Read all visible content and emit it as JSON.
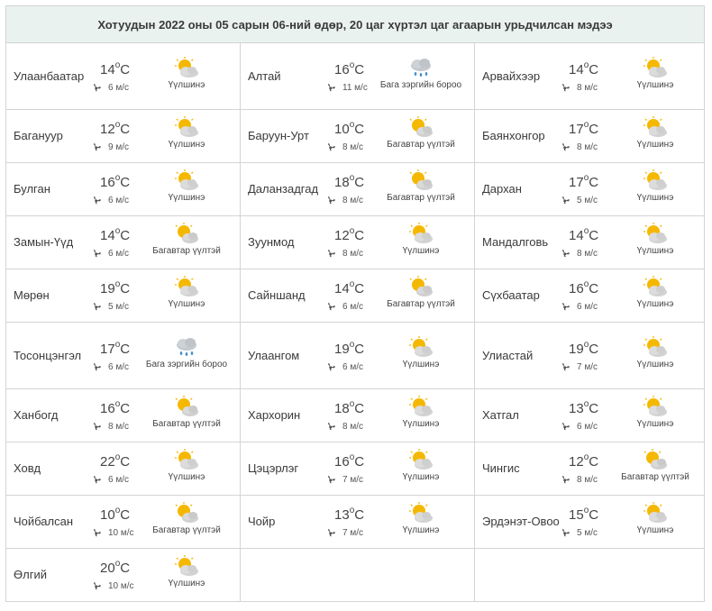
{
  "title": "Хотуудын 2022 оны 05 сарын 06-ний өдөр, 20 цаг хүртэл цаг агаарын урьдчилсан мэдээ",
  "unit": "C",
  "colors": {
    "header_bg": "#eaf2f0",
    "border": "#d4d4d4",
    "sun": "#f5b800",
    "cloud": "#c9c9c9"
  },
  "rows": [
    [
      {
        "city": "Улаанбаатар",
        "temp": "14",
        "wind": "6 м/с",
        "cond": "Үүлшинэ",
        "icon": "partly-cloudy-icon"
      },
      {
        "city": "Алтай",
        "temp": "16",
        "wind": "11 м/с",
        "cond": "Бага зэргийн бороо",
        "icon": "light-rain-icon"
      },
      {
        "city": "Арвайхээр",
        "temp": "14",
        "wind": "8 м/с",
        "cond": "Үүлшинэ",
        "icon": "partly-cloudy-icon"
      }
    ],
    [
      {
        "city": "Баганууp",
        "temp": "12",
        "wind": "9 м/с",
        "cond": "Үүлшинэ",
        "icon": "partly-cloudy-icon"
      },
      {
        "city": "Баруун-Урт",
        "temp": "10",
        "wind": "8 м/с",
        "cond": "Багавтар үүлтэй",
        "icon": "mostly-sunny-icon"
      },
      {
        "city": "Баянхонгор",
        "temp": "17",
        "wind": "8 м/с",
        "cond": "Үүлшинэ",
        "icon": "partly-cloudy-icon"
      }
    ],
    [
      {
        "city": "Булган",
        "temp": "16",
        "wind": "6 м/с",
        "cond": "Үүлшинэ",
        "icon": "partly-cloudy-icon"
      },
      {
        "city": "Даланзадгад",
        "temp": "18",
        "wind": "8 м/с",
        "cond": "Багавтар үүлтэй",
        "icon": "mostly-sunny-icon"
      },
      {
        "city": "Дархан",
        "temp": "17",
        "wind": "5 м/с",
        "cond": "Үүлшинэ",
        "icon": "partly-cloudy-icon"
      }
    ],
    [
      {
        "city": "Замын-Үүд",
        "temp": "14",
        "wind": "6 м/с",
        "cond": "Багавтар үүлтэй",
        "icon": "mostly-sunny-icon"
      },
      {
        "city": "Зуунмод",
        "temp": "12",
        "wind": "8 м/с",
        "cond": "Үүлшинэ",
        "icon": "partly-cloudy-icon"
      },
      {
        "city": "Мандалговь",
        "temp": "14",
        "wind": "8 м/с",
        "cond": "Үүлшинэ",
        "icon": "partly-cloudy-icon"
      }
    ],
    [
      {
        "city": "Мөрөн",
        "temp": "19",
        "wind": "5 м/с",
        "cond": "Үүлшинэ",
        "icon": "partly-cloudy-icon"
      },
      {
        "city": "Сайншанд",
        "temp": "14",
        "wind": "6 м/с",
        "cond": "Багавтар үүлтэй",
        "icon": "mostly-sunny-icon"
      },
      {
        "city": "Сүхбаатар",
        "temp": "16",
        "wind": "6 м/с",
        "cond": "Үүлшинэ",
        "icon": "partly-cloudy-icon"
      }
    ],
    [
      {
        "city": "Тосонцэнгэл",
        "temp": "17",
        "wind": "6 м/с",
        "cond": "Бага зэргийн бороо",
        "icon": "light-rain-icon"
      },
      {
        "city": "Улаангом",
        "temp": "19",
        "wind": "6 м/с",
        "cond": "Үүлшинэ",
        "icon": "partly-cloudy-icon"
      },
      {
        "city": "Улиастай",
        "temp": "19",
        "wind": "7 м/с",
        "cond": "Үүлшинэ",
        "icon": "partly-cloudy-icon"
      }
    ],
    [
      {
        "city": "Ханбогд",
        "temp": "16",
        "wind": "8 м/с",
        "cond": "Багавтар үүлтэй",
        "icon": "mostly-sunny-icon"
      },
      {
        "city": "Хархорин",
        "temp": "18",
        "wind": "8 м/с",
        "cond": "Үүлшинэ",
        "icon": "partly-cloudy-icon"
      },
      {
        "city": "Хатгал",
        "temp": "13",
        "wind": "6 м/с",
        "cond": "Үүлшинэ",
        "icon": "partly-cloudy-icon"
      }
    ],
    [
      {
        "city": "Ховд",
        "temp": "22",
        "wind": "6 м/с",
        "cond": "Үүлшинэ",
        "icon": "partly-cloudy-icon"
      },
      {
        "city": "Цэцэрлэг",
        "temp": "16",
        "wind": "7 м/с",
        "cond": "Үүлшинэ",
        "icon": "partly-cloudy-icon"
      },
      {
        "city": "Чингис",
        "temp": "12",
        "wind": "8 м/с",
        "cond": "Багавтар үүлтэй",
        "icon": "mostly-sunny-icon"
      }
    ],
    [
      {
        "city": "Чойбалсан",
        "temp": "10",
        "wind": "10 м/с",
        "cond": "Багавтар үүлтэй",
        "icon": "mostly-sunny-icon"
      },
      {
        "city": "Чойр",
        "temp": "13",
        "wind": "7 м/с",
        "cond": "Үүлшинэ",
        "icon": "partly-cloudy-icon"
      },
      {
        "city": "Эрдэнэт-Овоо",
        "temp": "15",
        "wind": "5 м/с",
        "cond": "Үүлшинэ",
        "icon": "partly-cloudy-icon"
      }
    ],
    [
      {
        "city": "Өлгий",
        "temp": "20",
        "wind": "10 м/с",
        "cond": "Үүлшинэ",
        "icon": "partly-cloudy-icon"
      },
      null,
      null
    ]
  ]
}
